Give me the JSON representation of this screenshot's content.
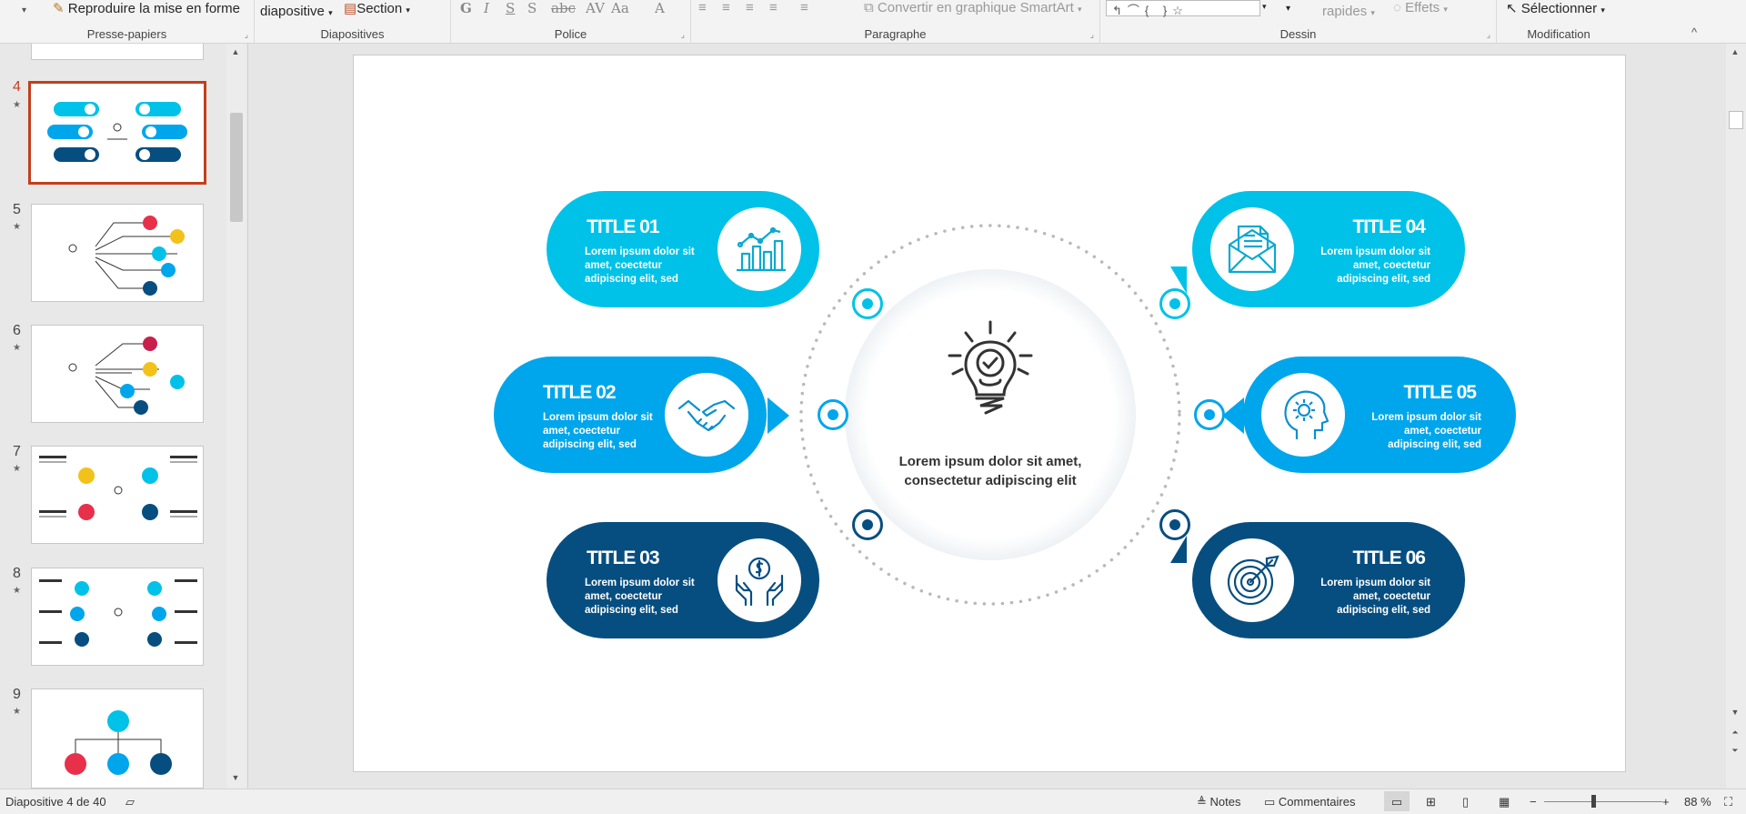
{
  "ribbon": {
    "groups": {
      "clipboard": "Presse-papiers",
      "slides": "Diapositives",
      "font": "Police",
      "paragraph": "Paragraphe",
      "drawing": "Dessin",
      "editing": "Modification"
    },
    "format_painter": "Reproduire la mise en forme",
    "slide_button": "diapositive",
    "section_button": "Section",
    "smartart": "Convertir en graphique SmartArt",
    "quick_styles": "rapides",
    "effects": "Effets",
    "select": "Sélectionner"
  },
  "thumbnails": [
    {
      "number": "4",
      "active": true
    },
    {
      "number": "5",
      "active": false
    },
    {
      "number": "6",
      "active": false
    },
    {
      "number": "7",
      "active": false
    },
    {
      "number": "8",
      "active": false
    },
    {
      "number": "9",
      "active": false
    }
  ],
  "slide": {
    "center_text": "Lorem ipsum dolor sit amet, consectetur adipiscing elit",
    "cards": [
      {
        "title": "TITLE 01",
        "text": "Lorem ipsum dolor sit amet, coectetur adipiscing elit, sed",
        "color": "#00c2e8",
        "icon": "bar-chart-icon"
      },
      {
        "title": "TITLE 02",
        "text": "Lorem ipsum dolor sit amet, coectetur adipiscing elit, sed",
        "color": "#00a6ec",
        "icon": "handshake-icon"
      },
      {
        "title": "TITLE 03",
        "text": "Lorem ipsum dolor sit amet, coectetur adipiscing elit, sed",
        "color": "#074e80",
        "icon": "money-hands-icon"
      },
      {
        "title": "TITLE 04",
        "text": "Lorem ipsum dolor sit amet, coectetur adipiscing elit, sed",
        "color": "#00c2e8",
        "icon": "mail-icon"
      },
      {
        "title": "TITLE 05",
        "text": "Lorem ipsum dolor sit amet, coectetur adipiscing elit, sed",
        "color": "#00a6ec",
        "icon": "head-gear-icon"
      },
      {
        "title": "TITLE 06",
        "text": "Lorem ipsum dolor sit amet, coectetur adipiscing elit, sed",
        "color": "#074e80",
        "icon": "target-icon"
      }
    ]
  },
  "status": {
    "slide_counter": "Diapositive 4 de 40",
    "notes": "Notes",
    "comments": "Commentaires",
    "zoom": "88 %"
  }
}
